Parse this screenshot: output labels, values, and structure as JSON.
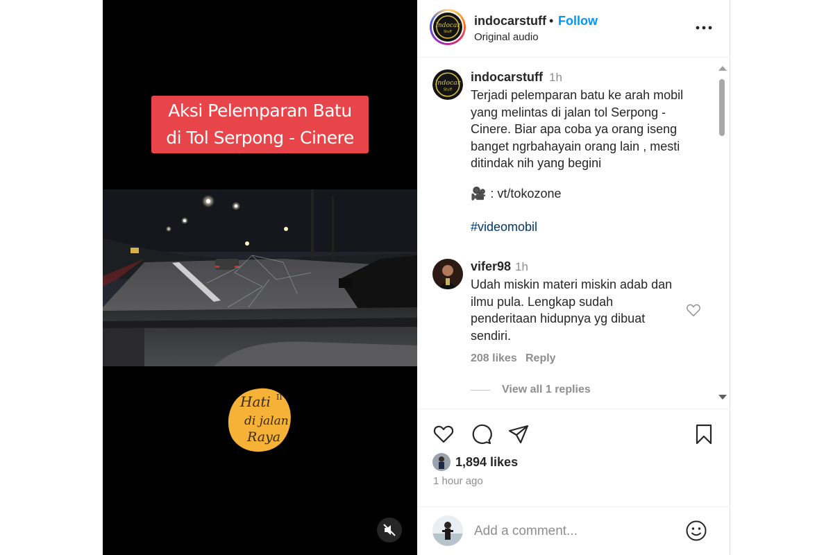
{
  "video": {
    "title_line1": "Aksi Pelemparan Batu",
    "title_line2": "di Tol Serpong - Cinere",
    "badge_icon": "hati-di-jalan-raya-logo",
    "mute_icon": "speaker-muted-icon"
  },
  "header": {
    "username": "indocarstuff",
    "separator": "•",
    "follow_label": "Follow",
    "audio_label": "Original audio",
    "more_icon": "more-options-icon"
  },
  "caption": {
    "username": "indocarstuff",
    "time": "1h",
    "text": "Terjadi pelemparan batu ke arah mobil yang melintas di jalan tol Serpong - Cinere. Biar apa coba ya orang iseng banget ngrbahayain orang lain , mesti ditindak nih yang begini",
    "credit_emoji": "🎥",
    "credit_text": ": vt/tokozone",
    "hashtag": "#videomobil"
  },
  "comment": {
    "username": "vifer98",
    "time": "1h",
    "text": "Udah miskin materi miskin adab dan ilmu pula. Lengkap sudah penderitaan hidupnya yg dibuat sendiri.",
    "likes": "208 likes",
    "reply_label": "Reply",
    "view_replies": "View all 1 replies"
  },
  "actions": {
    "icons": [
      "heart-icon",
      "comment-icon",
      "share-icon",
      "bookmark-icon"
    ],
    "likes_count": "1,894 likes",
    "posted": "1 hour ago"
  },
  "add_comment": {
    "placeholder": "Add a comment...",
    "emoji_icon": "smiley-icon"
  },
  "colors": {
    "follow": "#0095f6",
    "title_bg": "#e8454a",
    "hashtag": "#00376b",
    "muted_text": "#8e8e8e"
  }
}
